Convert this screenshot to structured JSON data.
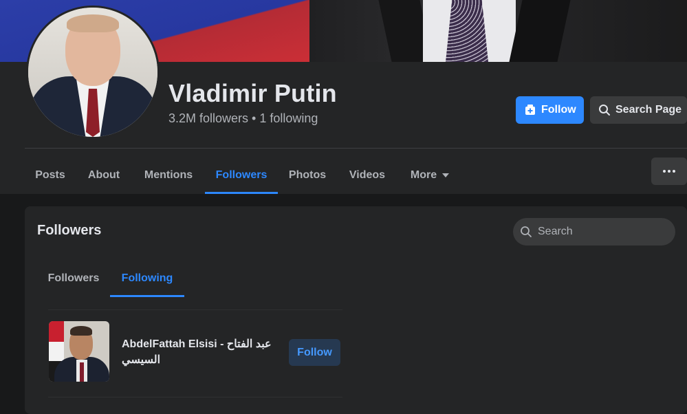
{
  "profile": {
    "name": "Vladimir Putin",
    "stats": "3.2M followers • 1 following"
  },
  "actions": {
    "follow_label": "Follow",
    "search_page_label": "Search Page"
  },
  "tabs": [
    {
      "label": "Posts"
    },
    {
      "label": "About"
    },
    {
      "label": "Mentions"
    },
    {
      "label": "Followers",
      "active": true
    },
    {
      "label": "Photos"
    },
    {
      "label": "Videos"
    },
    {
      "label": "More"
    }
  ],
  "followers_card": {
    "title": "Followers",
    "search_placeholder": "Search",
    "subtabs": [
      {
        "label": "Followers"
      },
      {
        "label": "Following",
        "active": true
      }
    ],
    "items": [
      {
        "name": "AbdelFattah Elsisi - عبد الفتاح السيسي",
        "button_label": "Follow"
      }
    ]
  },
  "colors": {
    "accent": "#2d88ff",
    "background": "#18191a",
    "surface": "#242526",
    "button_secondary": "#3a3b3c"
  },
  "icons": {
    "follow": "follow-page-icon",
    "search": "search-icon",
    "more": "more-dots-icon",
    "caret": "caret-down-icon"
  }
}
